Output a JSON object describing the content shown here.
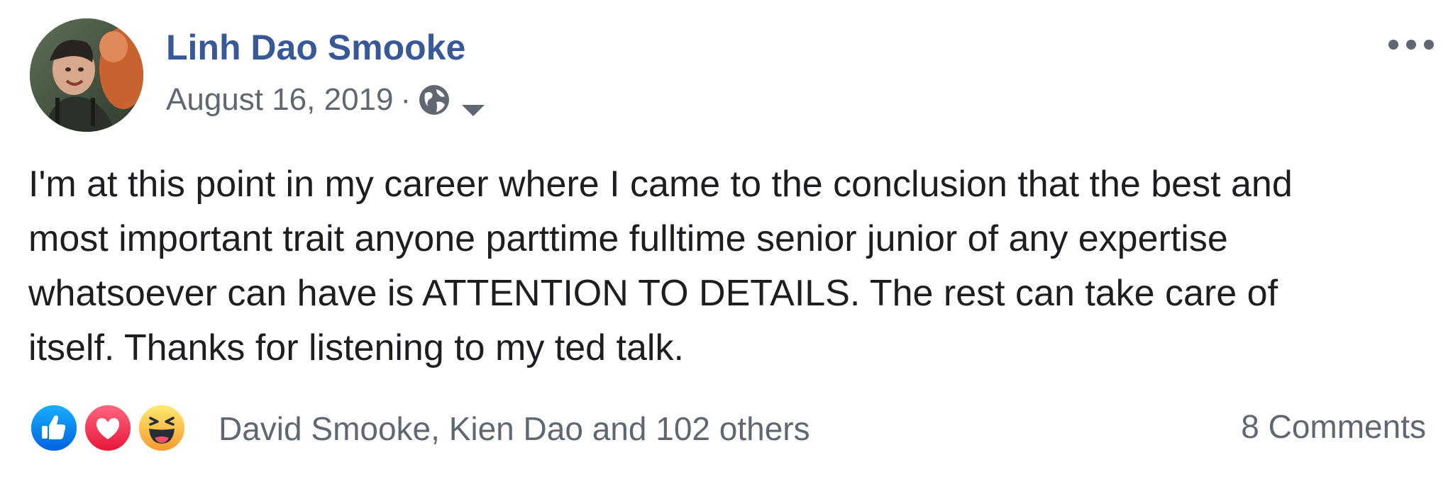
{
  "post": {
    "author": "Linh Dao Smooke",
    "date": "August 16, 2019",
    "separator": "·",
    "privacy_icon": "globe-icon",
    "menu_icon": "more-options-icon",
    "text_lines": [
      "I'm at this point in my career where I came to the conclusion that the best and",
      "most important trait anyone parttime fulltime senior junior of any expertise",
      "whatsoever can have is ATTENTION TO DETAILS. The rest can take care of",
      "itself. Thanks for listening to my ted talk."
    ],
    "reactions": {
      "icons": [
        "like-icon",
        "love-icon",
        "haha-icon"
      ],
      "summary": "David Smooke, Kien Dao and 102 others"
    },
    "comments": "8 Comments"
  },
  "colors": {
    "author_link": "#385898",
    "secondary_text": "#606770",
    "body_text": "#1c1e21",
    "like_blue": "#1877f2",
    "love_red": "#f33e58",
    "haha_yellow": "#f7b125"
  }
}
